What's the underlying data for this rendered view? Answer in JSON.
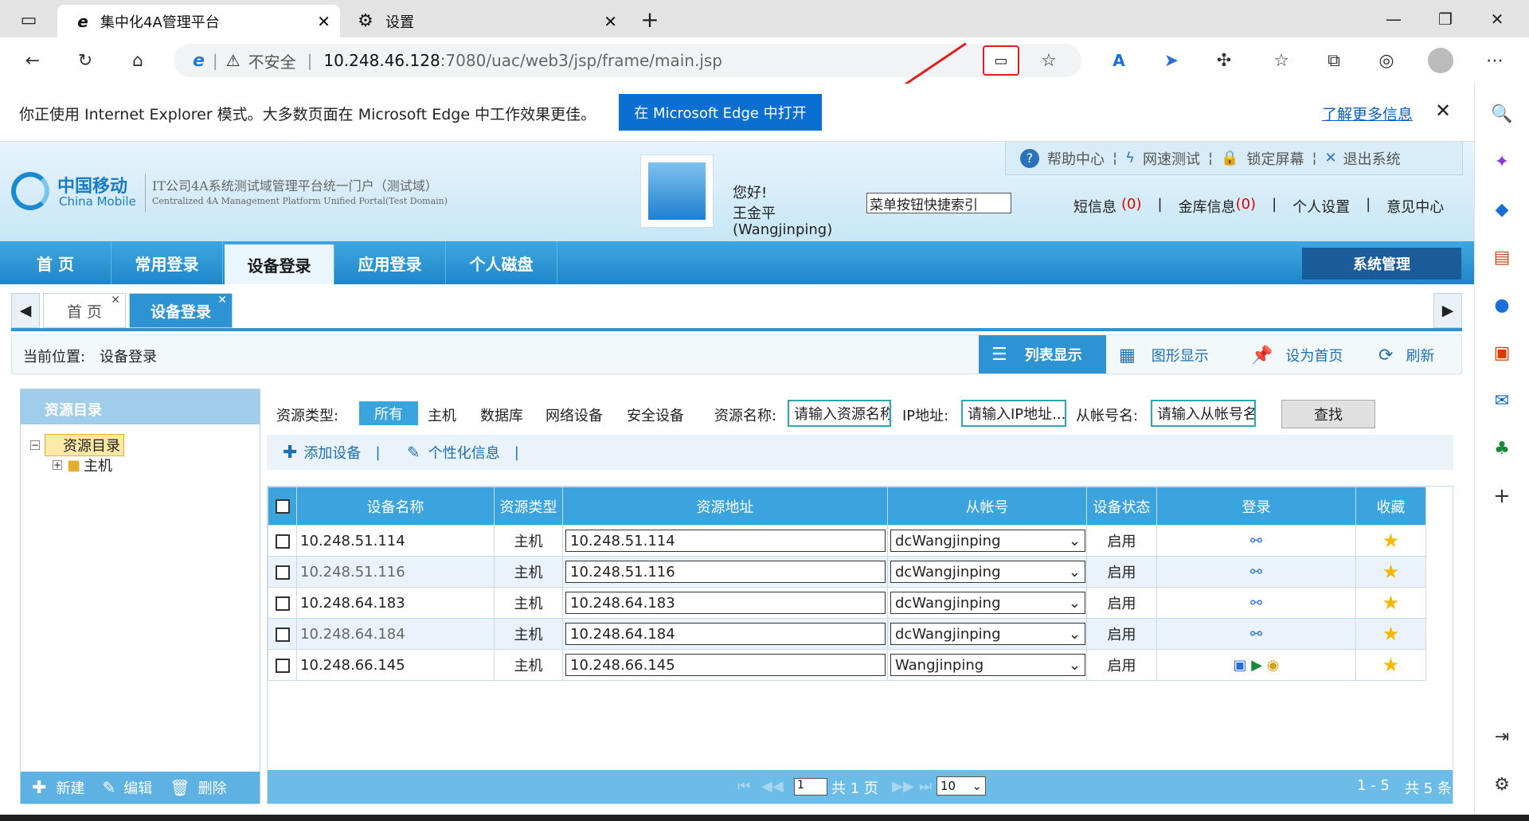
{
  "browser": {
    "tabs": [
      {
        "title": "集中化4A管理平台"
      },
      {
        "title": "设置"
      }
    ],
    "url_host": "10.248.46.128",
    "url_path": ":7080/uac/web3/jsp/frame/main.jsp",
    "security": "不安全"
  },
  "iebar": {
    "message": "你正使用 Internet Explorer 模式。大多数页面在 Microsoft Edge 中工作效果更佳。",
    "open_button": "在 Microsoft Edge 中打开",
    "learn_more": "了解更多信息"
  },
  "header": {
    "logo_cn": "中国移动",
    "logo_en": "China Mobile",
    "platform_title": "IT公司4A系统测试域管理平台统一门户（测试域）",
    "platform_sub": "Centralized 4A Management Platform Unified Portal(Test Domain)",
    "greeting": "您好!",
    "user_name": "王金平",
    "user_id": "(Wangjinping)",
    "quick_search_placeholder": "菜单按钮快捷索引",
    "top_links": {
      "help": "帮助中心",
      "speed": "网速测试",
      "lock": "锁定屏幕",
      "logout": "退出系统"
    },
    "msg_label": "短信息",
    "msg_count": "(0)",
    "vault_label": "金库信息",
    "vault_count": "(0)",
    "personal": "个人设置",
    "feedback": "意见中心"
  },
  "nav": {
    "items": [
      "首 页",
      "常用登录",
      "设备登录",
      "应用登录",
      "个人磁盘"
    ],
    "system": "系统管理"
  },
  "pagetabs": [
    "首 页",
    "设备登录"
  ],
  "crumb": {
    "label": "当前位置:",
    "value": "设备登录",
    "list_view": "列表显示",
    "graph_view": "图形显示",
    "set_home": "设为首页",
    "refresh": "刷新"
  },
  "tree": {
    "title": "资源目录",
    "root": "资源目录",
    "child": "主机",
    "new": "新建",
    "edit": "编辑",
    "delete": "删除"
  },
  "filter": {
    "type_label": "资源类型:",
    "types": [
      "所有",
      "主机",
      "数据库",
      "网络设备",
      "安全设备"
    ],
    "name_label": "资源名称:",
    "name_placeholder": "请输入资源名称",
    "ip_label": "IP地址:",
    "ip_placeholder": "请输入IP地址...",
    "account_label": "从帐号名:",
    "account_placeholder": "请输入从帐号名",
    "search": "查找",
    "add": "添加设备",
    "personalize": "个性化信息"
  },
  "table": {
    "headers": [
      "设备名称",
      "资源类型",
      "资源地址",
      "从帐号",
      "设备状态",
      "登录",
      "收藏"
    ],
    "rows": [
      {
        "name": "10.248.51.114",
        "type": "主机",
        "addr": "10.248.51.114",
        "account": "dcWangjinping",
        "status": "启用"
      },
      {
        "name": "10.248.51.116",
        "type": "主机",
        "addr": "10.248.51.116",
        "account": "dcWangjinping",
        "status": "启用"
      },
      {
        "name": "10.248.64.183",
        "type": "主机",
        "addr": "10.248.64.183",
        "account": "dcWangjinping",
        "status": "启用"
      },
      {
        "name": "10.248.64.184",
        "type": "主机",
        "addr": "10.248.64.184",
        "account": "dcWangjinping",
        "status": "启用"
      },
      {
        "name": "10.248.66.145",
        "type": "主机",
        "addr": "10.248.66.145",
        "account": "Wangjinping",
        "status": "启用"
      }
    ]
  },
  "pager": {
    "page": "1",
    "total_pages": "共 1 页",
    "page_size": "10",
    "range": "1 - 5",
    "total": "共 5 条"
  }
}
